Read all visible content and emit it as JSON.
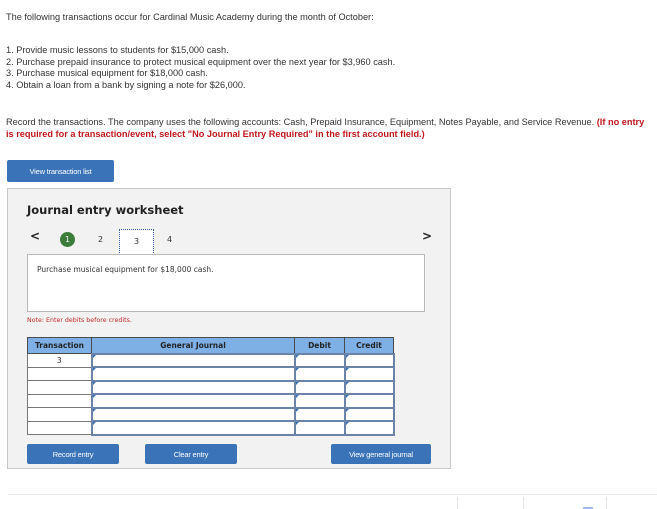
{
  "intro": "The following transactions occur for Cardinal Music Academy during the month of October:",
  "transactions": [
    "1. Provide music lessons to students for $15,000 cash.",
    "2. Purchase prepaid insurance to protect musical equipment over the next year for $3,960 cash.",
    "3. Purchase musical equipment for $18,000 cash.",
    "4. Obtain a loan from a bank by signing a note for $26,000."
  ],
  "instructions": {
    "text": "Record the transactions. The company uses the following accounts: Cash, Prepaid Insurance, Equipment, Notes Payable, and Service Revenue.",
    "warning": "(If no entry is required for a transaction/event, select \"No Journal Entry Required\" in the first account field.)"
  },
  "buttons": {
    "view_transaction_list": "View transaction list",
    "record_entry": "Record entry",
    "clear_entry": "Clear entry",
    "view_general_journal": "View general journal"
  },
  "worksheet": {
    "title": "Journal entry worksheet",
    "nav_prev": "<",
    "nav_next": ">",
    "steps": [
      "1",
      "2",
      "3",
      "4"
    ],
    "completed_step": "1",
    "active_step": "3",
    "description": "Purchase musical equipment for $18,000 cash.",
    "note": "Note: Enter debits before credits."
  },
  "journal": {
    "headers": {
      "transaction": "Transaction",
      "general_journal": "General Journal",
      "debit": "Debit",
      "credit": "Credit"
    },
    "rows": [
      {
        "transaction": "3",
        "account": "",
        "debit": "",
        "credit": ""
      },
      {
        "transaction": "",
        "account": "",
        "debit": "",
        "credit": ""
      },
      {
        "transaction": "",
        "account": "",
        "debit": "",
        "credit": ""
      },
      {
        "transaction": "",
        "account": "",
        "debit": "",
        "credit": ""
      },
      {
        "transaction": "",
        "account": "",
        "debit": "",
        "credit": ""
      },
      {
        "transaction": "",
        "account": "",
        "debit": "",
        "credit": ""
      }
    ]
  },
  "colors": {
    "button_blue": "#3a73b8",
    "header_blue": "#7eb0e6",
    "completed_green": "#3d7d3a",
    "warning_red": "#c0171c"
  }
}
